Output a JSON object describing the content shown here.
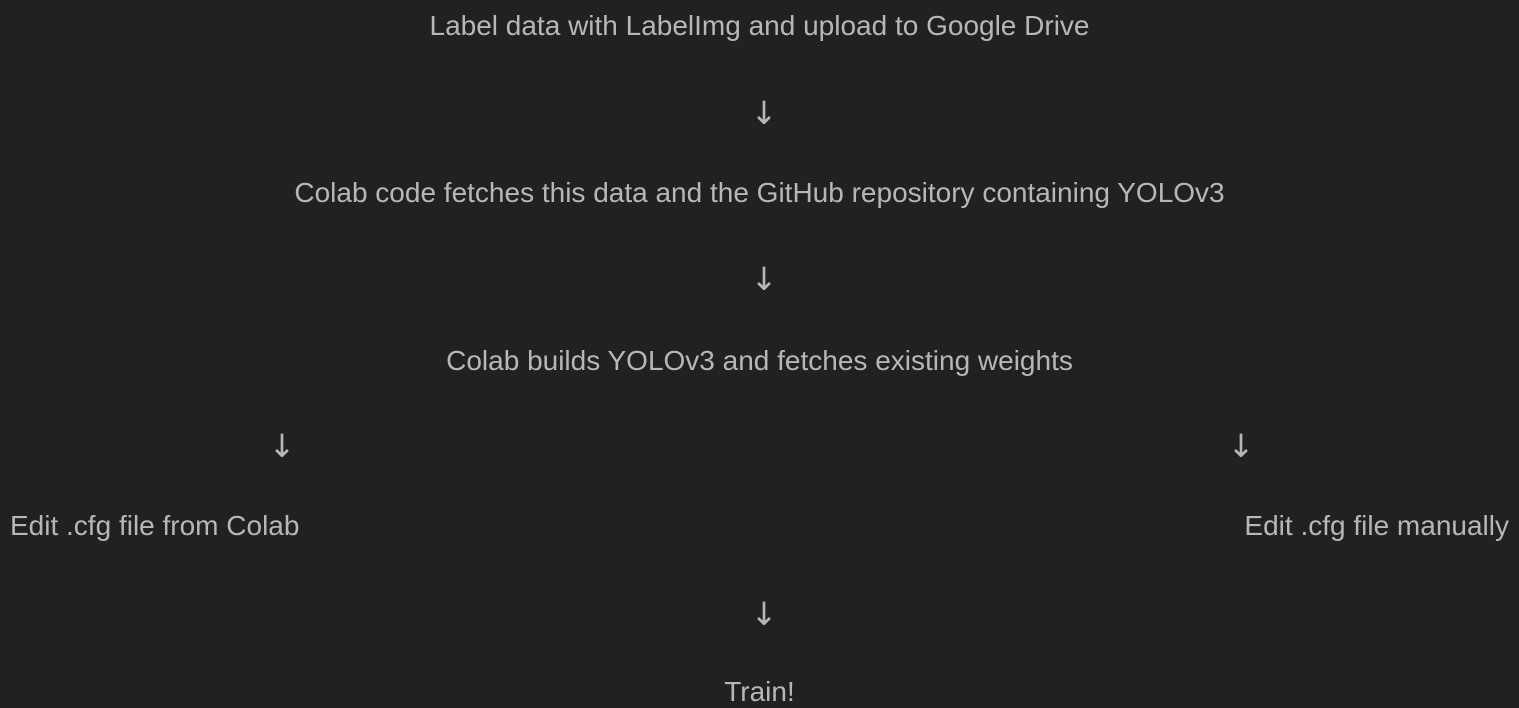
{
  "flow": {
    "step1": "Label data with LabelImg and upload to Google Drive",
    "step2": "Colab code fetches this data and the GitHub repository containing YOLOv3",
    "step3": "Colab builds YOLOv3 and fetches existing weights",
    "step4_left": "Edit .cfg file from Colab",
    "step4_right": "Edit .cfg file manually",
    "step5": "Train!",
    "arrow_glyph": "↓"
  },
  "colors": {
    "background": "#212121",
    "text": "#b7b7b7"
  }
}
